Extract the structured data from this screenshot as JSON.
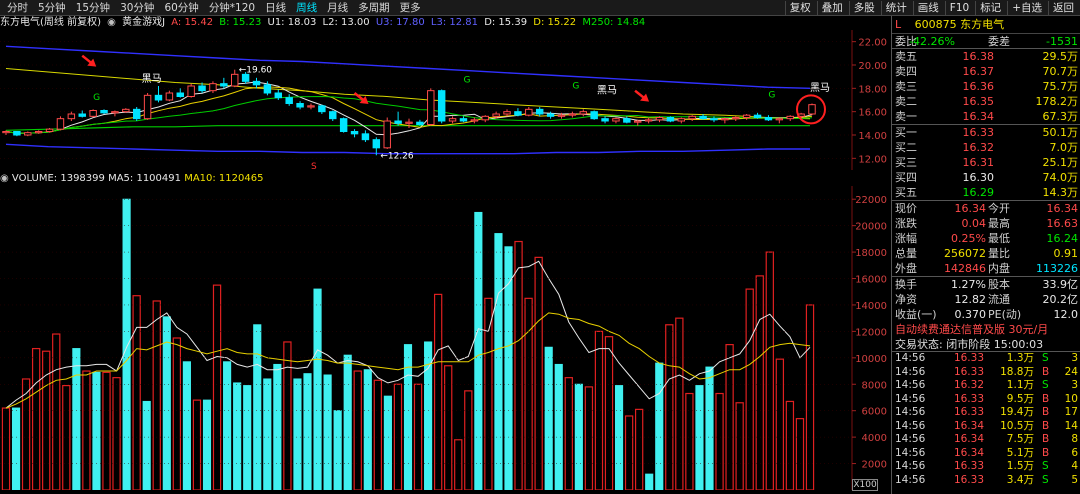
{
  "toolbar": {
    "tabs": [
      "分时",
      "5分钟",
      "15分钟",
      "30分钟",
      "60分钟",
      "分钟*120",
      "日线",
      "周线",
      "月线",
      "多周期",
      "更多"
    ],
    "active_tab": "周线",
    "tools": [
      "复权",
      "叠加",
      "多股",
      "统计",
      "画线",
      "F10",
      "标记",
      "+自选",
      "返回"
    ]
  },
  "info": {
    "title": "东方电气(周线 前复权)",
    "indicator": "黄金游戏J",
    "a": "A: 15.42",
    "b": "B: 15.23",
    "u1": "U1: 18.03",
    "l2": "L2: 13.00",
    "u3": "U3: 17.80",
    "l3": "L3: 12.81",
    "v1": "D: 15.39",
    "v2": "D: 15.22",
    "m250": "M250: 14.84"
  },
  "price_axis": [
    "22.00",
    "20.00",
    "18.00",
    "16.00",
    "14.00",
    "12.00"
  ],
  "price_annotations": {
    "high": "19.60",
    "low": "12.26",
    "label1": "黑马",
    "label2": "黑马",
    "label3": "黑马",
    "g1": "G",
    "g2": "G",
    "g3": "G",
    "g4": "G",
    "s1": "S"
  },
  "volume": {
    "header": "VOLUME: 1398399",
    "ma5": "MA5: 1100491",
    "ma10": "MA10: 1120465",
    "axis": [
      "22000",
      "20000",
      "18000",
      "16000",
      "14000",
      "12000",
      "10000",
      "8000",
      "6000",
      "4000",
      "2000"
    ],
    "scale": "X100"
  },
  "chart_data": [
    {
      "type": "candlestick",
      "title": "东方电气(周线 前复权)",
      "ylim": [
        11.5,
        23
      ],
      "note": "weekly candles; values estimated from axis",
      "candles": [
        [
          14.2,
          14.4,
          14.0,
          14.3
        ],
        [
          14.3,
          14.3,
          13.9,
          14.0
        ],
        [
          14.0,
          14.3,
          13.9,
          14.2
        ],
        [
          14.2,
          14.4,
          14.1,
          14.3
        ],
        [
          14.3,
          14.6,
          14.2,
          14.5
        ],
        [
          14.5,
          15.6,
          14.4,
          15.4
        ],
        [
          15.4,
          16.0,
          15.2,
          15.8
        ],
        [
          15.8,
          16.1,
          15.5,
          15.6
        ],
        [
          15.6,
          16.2,
          15.5,
          16.1
        ],
        [
          16.1,
          16.2,
          15.8,
          15.9
        ],
        [
          15.9,
          16.1,
          15.6,
          16.0
        ],
        [
          16.0,
          16.3,
          15.9,
          16.2
        ],
        [
          16.2,
          16.4,
          15.2,
          15.4
        ],
        [
          15.4,
          17.6,
          15.3,
          17.4
        ],
        [
          17.4,
          18.2,
          16.8,
          17.0
        ],
        [
          17.0,
          17.8,
          16.9,
          17.6
        ],
        [
          17.6,
          18.0,
          17.2,
          17.3
        ],
        [
          17.3,
          18.4,
          17.2,
          18.2
        ],
        [
          18.2,
          18.5,
          17.6,
          17.8
        ],
        [
          17.8,
          18.6,
          17.6,
          18.4
        ],
        [
          18.4,
          18.9,
          18.0,
          18.2
        ],
        [
          18.2,
          19.6,
          18.1,
          19.2
        ],
        [
          19.2,
          19.4,
          18.4,
          18.6
        ],
        [
          18.6,
          18.9,
          18.0,
          18.3
        ],
        [
          18.3,
          18.6,
          17.4,
          17.6
        ],
        [
          17.6,
          17.9,
          17.0,
          17.2
        ],
        [
          17.2,
          17.5,
          16.5,
          16.7
        ],
        [
          16.7,
          16.9,
          16.2,
          16.4
        ],
        [
          16.4,
          16.7,
          16.2,
          16.5
        ],
        [
          16.5,
          16.6,
          15.8,
          16.0
        ],
        [
          16.0,
          16.1,
          15.2,
          15.4
        ],
        [
          15.4,
          15.5,
          14.2,
          14.3
        ],
        [
          14.3,
          14.5,
          13.8,
          14.1
        ],
        [
          14.1,
          14.4,
          13.4,
          13.6
        ],
        [
          13.6,
          13.8,
          12.26,
          12.9
        ],
        [
          12.9,
          15.5,
          12.8,
          15.2
        ],
        [
          15.2,
          16.0,
          14.8,
          15.0
        ],
        [
          15.0,
          15.4,
          14.6,
          15.1
        ],
        [
          15.1,
          15.3,
          14.8,
          14.9
        ],
        [
          14.9,
          18.0,
          14.8,
          17.8
        ],
        [
          17.8,
          17.9,
          15.0,
          15.2
        ],
        [
          15.2,
          15.6,
          15.0,
          15.4
        ],
        [
          15.4,
          15.6,
          15.1,
          15.2
        ],
        [
          15.2,
          15.5,
          15.0,
          15.3
        ],
        [
          15.3,
          15.7,
          15.1,
          15.6
        ],
        [
          15.6,
          16.0,
          15.4,
          15.8
        ],
        [
          15.8,
          16.2,
          15.6,
          16.0
        ],
        [
          16.0,
          16.3,
          15.6,
          15.7
        ],
        [
          15.7,
          16.4,
          15.6,
          16.2
        ],
        [
          16.2,
          16.4,
          15.6,
          15.8
        ],
        [
          15.8,
          16.0,
          15.4,
          15.6
        ],
        [
          15.6,
          15.9,
          15.4,
          15.7
        ],
        [
          15.7,
          16.0,
          15.5,
          15.8
        ],
        [
          15.8,
          16.2,
          15.6,
          16.0
        ],
        [
          16.0,
          16.1,
          15.3,
          15.4
        ],
        [
          15.4,
          15.6,
          15.0,
          15.2
        ],
        [
          15.2,
          15.5,
          15.0,
          15.4
        ],
        [
          15.4,
          15.6,
          15.0,
          15.1
        ],
        [
          15.1,
          15.3,
          14.8,
          15.2
        ],
        [
          15.2,
          15.5,
          15.0,
          15.3
        ],
        [
          15.3,
          15.6,
          15.1,
          15.5
        ],
        [
          15.5,
          15.6,
          15.1,
          15.2
        ],
        [
          15.2,
          15.5,
          15.0,
          15.4
        ],
        [
          15.4,
          15.7,
          15.2,
          15.6
        ],
        [
          15.6,
          15.8,
          15.3,
          15.4
        ],
        [
          15.4,
          15.6,
          15.1,
          15.3
        ],
        [
          15.3,
          15.5,
          15.0,
          15.4
        ],
        [
          15.4,
          15.6,
          15.2,
          15.5
        ],
        [
          15.5,
          15.8,
          15.3,
          15.7
        ],
        [
          15.7,
          15.9,
          15.4,
          15.5
        ],
        [
          15.5,
          15.7,
          15.2,
          15.3
        ],
        [
          15.3,
          15.5,
          15.0,
          15.4
        ],
        [
          15.4,
          15.7,
          15.2,
          15.6
        ],
        [
          15.6,
          15.9,
          15.4,
          15.8
        ],
        [
          15.8,
          16.7,
          15.7,
          16.6
        ]
      ],
      "lines": {
        "upper_band": [
          21.6,
          21.4,
          21.2,
          21.0,
          20.8,
          20.6,
          20.4,
          20.3,
          20.1,
          19.9,
          19.7,
          19.5,
          19.3,
          19.1,
          18.9,
          18.7,
          18.5,
          18.3,
          18.1,
          18.0
        ],
        "lower_band": [
          13.2,
          13.0,
          12.9,
          12.8,
          12.7,
          12.6,
          12.6,
          12.5,
          12.5,
          12.4,
          12.4,
          12.4,
          12.4,
          12.5,
          12.5,
          12.6,
          12.6,
          12.7,
          12.8,
          12.8
        ],
        "ma250": [
          14.4,
          14.5,
          14.6,
          14.7,
          14.7,
          14.8,
          14.8,
          14.8,
          14.8,
          14.8,
          14.8,
          14.8,
          14.8,
          14.8,
          14.8,
          14.8,
          14.8,
          14.8,
          14.8,
          14.8
        ],
        "trend_yellow": [
          19.7,
          19.4,
          19.1,
          18.8,
          18.5,
          18.3,
          18.0,
          17.8,
          17.5,
          17.3,
          17.0,
          16.8,
          16.6,
          16.4,
          16.2,
          16.0,
          15.8,
          15.7,
          15.5,
          15.4
        ]
      }
    },
    {
      "type": "bar",
      "title": "VOLUME",
      "ylabel": "X100",
      "ylim": [
        0,
        23000
      ],
      "values": [
        6200,
        6200,
        8400,
        10700,
        10500,
        11800,
        7900,
        10700,
        9000,
        8900,
        8900,
        8500,
        22000,
        14700,
        6700,
        14300,
        13100,
        11500,
        9700,
        6800,
        6800,
        15500,
        9700,
        8100,
        7900,
        12500,
        8400,
        9500,
        11200,
        8400,
        8800,
        15200,
        8700,
        6000,
        10200,
        9000,
        9100,
        8300,
        7100,
        8000,
        11000,
        8000,
        11200,
        14800,
        9400,
        3800,
        7500,
        21000,
        14500,
        19400,
        18400,
        18800,
        14500,
        17600,
        10800,
        9500,
        8500,
        8000,
        7800,
        12000,
        11600,
        7900,
        5600,
        6100,
        1200,
        9600,
        12500,
        13000,
        7300,
        7900,
        9300,
        7300,
        11000,
        6600,
        15200,
        16200,
        18000,
        9900,
        6700,
        5400,
        14000
      ],
      "series": [
        {
          "name": "MA5",
          "values": [
            6200,
            6800,
            7300,
            8100,
            8700,
            9100,
            9300,
            9400,
            9400,
            9500,
            9500,
            9000,
            10800,
            12300,
            12300,
            12900,
            13400,
            12300,
            11800,
            10800,
            9800,
            10100,
            10000,
            9500,
            9300,
            9500,
            9100,
            9100,
            9300,
            9200,
            9300,
            10600,
            10200,
            9600,
            9800,
            9700,
            9400,
            8500,
            8100,
            8300,
            8700,
            8600,
            9200,
            10600,
            10900,
            9800,
            10100,
            12200,
            12000,
            14900,
            15600,
            16800,
            16900,
            17300,
            16000,
            14800,
            12700,
            11500,
            10400,
            10700,
            10700,
            9600,
            8700,
            7800,
            6900,
            7300,
            8400,
            8700,
            8300,
            8800,
            9000,
            9700,
            10000,
            10300,
            11300,
            12900,
            13300,
            12400,
            11600,
            10000,
            10800
          ]
        },
        {
          "name": "MA10",
          "values": [
            6200,
            6500,
            6900,
            7400,
            7900,
            8300,
            8400,
            8700,
            8700,
            9000,
            9000,
            9000,
            9800,
            10700,
            10600,
            10900,
            11200,
            11000,
            10700,
            10500,
            10300,
            10500,
            10700,
            10400,
            10300,
            10300,
            10000,
            9900,
            9800,
            9700,
            9800,
            9900,
            9800,
            9600,
            9600,
            9500,
            9400,
            9300,
            9200,
            9100,
            9300,
            9300,
            9500,
            9700,
            9700,
            9700,
            9700,
            10200,
            10400,
            10700,
            10900,
            11300,
            12000,
            12800,
            13400,
            13300,
            13000,
            12900,
            12600,
            12400,
            12000,
            11700,
            11100,
            10700,
            10100,
            9600,
            9400,
            9300,
            8800,
            8400,
            8500,
            8800,
            9100,
            9100,
            9500,
            10100,
            10800,
            11000,
            11100,
            11000,
            10900
          ]
        }
      ]
    }
  ],
  "panel": {
    "prefix": "L",
    "code": "600875",
    "name": "东方电气",
    "ratio_label": "委比",
    "ratio_value": "-42.26%",
    "diff_label": "委差",
    "diff_value": "-1531",
    "asks": [
      {
        "label": "卖五",
        "price": "16.38",
        "vol": "29.5万"
      },
      {
        "label": "卖四",
        "price": "16.37",
        "vol": "70.7万"
      },
      {
        "label": "卖三",
        "price": "16.36",
        "vol": "75.7万"
      },
      {
        "label": "卖二",
        "price": "16.35",
        "vol": "178.2万"
      },
      {
        "label": "卖一",
        "price": "16.34",
        "vol": "67.3万"
      }
    ],
    "bids": [
      {
        "label": "买一",
        "price": "16.33",
        "vol": "50.1万"
      },
      {
        "label": "买二",
        "price": "16.32",
        "vol": "7.0万"
      },
      {
        "label": "买三",
        "price": "16.31",
        "vol": "25.1万"
      },
      {
        "label": "买四",
        "price": "16.30",
        "vol": "74.0万"
      },
      {
        "label": "买五",
        "price": "16.29",
        "vol": "14.3万"
      }
    ],
    "stats": [
      {
        "l1": "现价",
        "v1": "16.34",
        "l2": "今开",
        "v2": "16.34"
      },
      {
        "l1": "涨跌",
        "v1": "0.04",
        "l2": "最高",
        "v2": "16.63"
      },
      {
        "l1": "涨幅",
        "v1": "0.25%",
        "l2": "最低",
        "v2": "16.24"
      },
      {
        "l1": "总量",
        "v1": "256072",
        "l2": "量比",
        "v2": "0.91"
      },
      {
        "l1": "外盘",
        "v1": "142846",
        "l2": "内盘",
        "v2": "113226"
      }
    ],
    "fund": [
      {
        "l1": "换手",
        "v1": "1.27%",
        "l2": "股本",
        "v2": "33.9亿"
      },
      {
        "l1": "净资",
        "v1": "12.82",
        "l2": "流通",
        "v2": "20.2亿"
      },
      {
        "l1": "收益(一)",
        "v1": "0.370",
        "l2": "PE(动)",
        "v2": "12.0"
      }
    ],
    "promo": "自动续费通达信普及版 30元/月",
    "trade_status": "交易状态: 闭市阶段 15:00:03",
    "trades": [
      {
        "t": "14:56",
        "p": "16.33",
        "v": "1.3万",
        "s": "S",
        "n": "3"
      },
      {
        "t": "14:56",
        "p": "16.33",
        "v": "18.8万",
        "s": "B",
        "n": "24"
      },
      {
        "t": "14:56",
        "p": "16.32",
        "v": "1.1万",
        "s": "S",
        "n": "3"
      },
      {
        "t": "14:56",
        "p": "16.33",
        "v": "9.5万",
        "s": "B",
        "n": "10"
      },
      {
        "t": "14:56",
        "p": "16.33",
        "v": "19.4万",
        "s": "B",
        "n": "17"
      },
      {
        "t": "14:56",
        "p": "16.34",
        "v": "10.5万",
        "s": "B",
        "n": "14"
      },
      {
        "t": "14:56",
        "p": "16.34",
        "v": "7.5万",
        "s": "B",
        "n": "8"
      },
      {
        "t": "14:56",
        "p": "16.34",
        "v": "5.1万",
        "s": "B",
        "n": "6"
      },
      {
        "t": "14:56",
        "p": "16.33",
        "v": "1.5万",
        "s": "S",
        "n": "4"
      },
      {
        "t": "14:56",
        "p": "16.33",
        "v": "3.4万",
        "s": "S",
        "n": "5"
      }
    ]
  },
  "colors": {
    "up": "#ff4a4a",
    "down": "#00e5ff",
    "ma5": "#e8e8e8",
    "ma10": "#e8d000",
    "band": "#3030ff",
    "ma250": "#00cc00",
    "trend": "#d8d800"
  }
}
